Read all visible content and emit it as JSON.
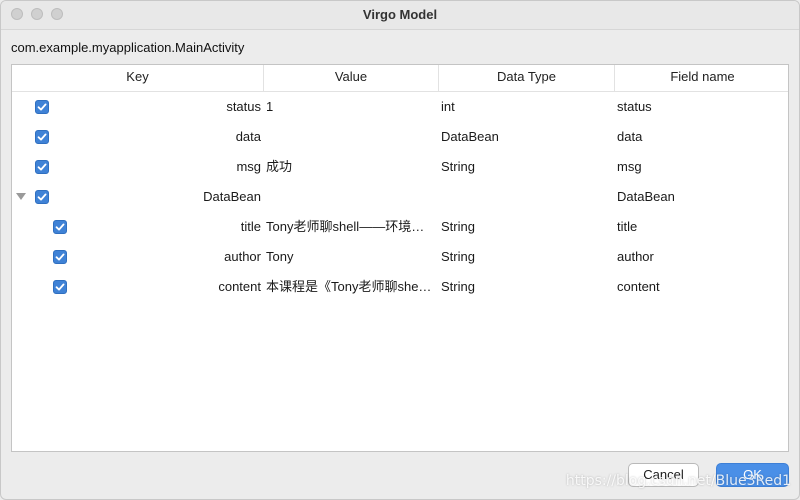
{
  "window": {
    "title": "Virgo Model"
  },
  "class_path": "com.example.myapplication.MainActivity",
  "table": {
    "columns": {
      "key": "Key",
      "value": "Value",
      "data_type": "Data Type",
      "field_name": "Field name"
    },
    "rows": [
      {
        "key": "status",
        "value": "1",
        "data_type": "int",
        "field_name": "status",
        "checked": true,
        "level": 0
      },
      {
        "key": "data",
        "value": "",
        "data_type": "DataBean",
        "field_name": "data",
        "checked": true,
        "level": 0
      },
      {
        "key": "msg",
        "value": "成功",
        "data_type": "String",
        "field_name": "msg",
        "checked": true,
        "level": 0
      },
      {
        "key": "DataBean",
        "value": "",
        "data_type": "",
        "field_name": "DataBean",
        "checked": true,
        "level": 0,
        "expanded": true
      },
      {
        "key": "title",
        "value": "Tony老师聊shell——环境…",
        "data_type": "String",
        "field_name": "title",
        "checked": true,
        "level": 1
      },
      {
        "key": "author",
        "value": "Tony",
        "data_type": "String",
        "field_name": "author",
        "checked": true,
        "level": 1
      },
      {
        "key": "content",
        "value": "本课程是《Tony老师聊she…",
        "data_type": "String",
        "field_name": "content",
        "checked": true,
        "level": 1
      }
    ]
  },
  "buttons": {
    "cancel": "Cancel",
    "ok": "OK"
  },
  "watermark": "https://blog.csdn.net/Blue3Red1",
  "colors": {
    "accent": "#4a8fe7",
    "checkbox": "#3f82d6"
  }
}
